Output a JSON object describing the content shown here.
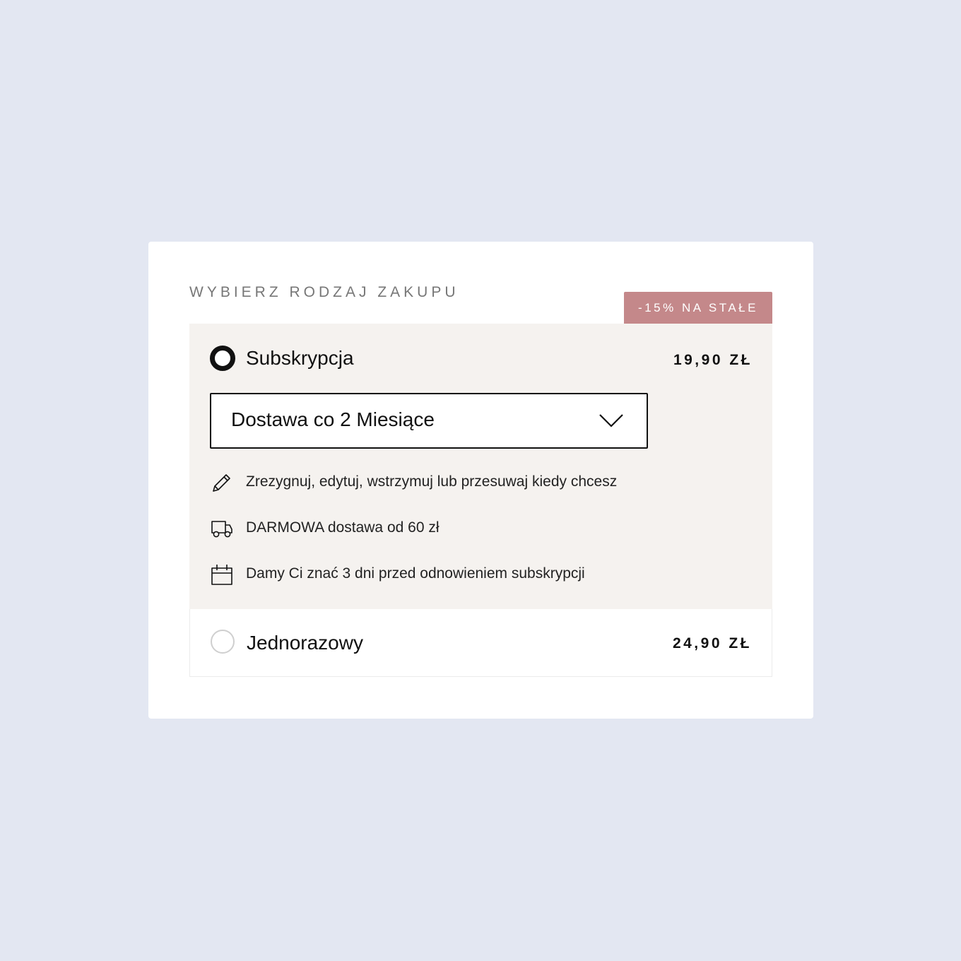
{
  "purchase": {
    "title": "WYBIERZ RODZAJ ZAKUPU",
    "discount_badge": "-15% NA STAŁE",
    "subscription": {
      "label": "Subskrypcja",
      "price": "19,90 ZŁ",
      "selected": true,
      "delivery_select": {
        "value": "Dostawa co 2 Miesiące"
      },
      "features": [
        {
          "icon": "pencil-icon",
          "text": "Zrezygnuj, edytuj, wstrzymuj lub przesuwaj kiedy chcesz"
        },
        {
          "icon": "truck-icon",
          "text": "DARMOWA dostawa od 60 zł"
        },
        {
          "icon": "calendar-icon",
          "text": "Damy Ci znać 3 dni przed odnowieniem subskrypcji"
        }
      ]
    },
    "one_time": {
      "label": "Jednorazowy",
      "price": "24,90 ZŁ",
      "selected": false
    }
  },
  "colors": {
    "background": "#e3e7f2",
    "card": "#ffffff",
    "selected_option_bg": "#f5f2ef",
    "badge": "#c4888a",
    "text": "#111111",
    "muted_title": "#777777"
  }
}
